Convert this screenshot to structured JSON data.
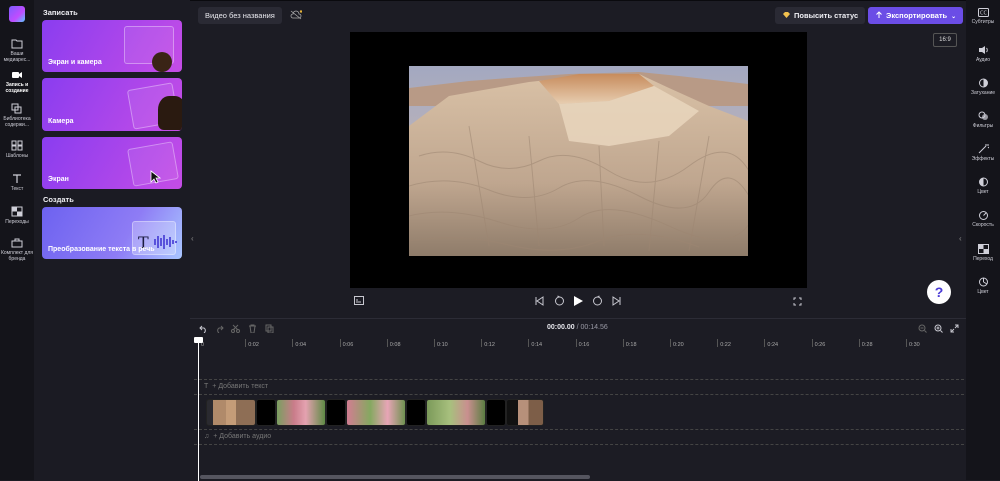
{
  "rail": {
    "items": [
      {
        "label": "Ваши медиарес...",
        "icon": "folder-icon"
      },
      {
        "label": "Запись и создание",
        "icon": "camera-icon"
      },
      {
        "label": "Библиотека содержи...",
        "icon": "library-icon"
      },
      {
        "label": "Шаблоны",
        "icon": "templates-icon"
      },
      {
        "label": "Текст",
        "icon": "text-icon"
      },
      {
        "label": "Переходы",
        "icon": "transitions-icon"
      },
      {
        "label": "Комплект для бренда",
        "icon": "brand-kit-icon"
      }
    ]
  },
  "panel": {
    "record_title": "Записать",
    "create_title": "Создать",
    "cards": [
      {
        "label": "Экран и камера"
      },
      {
        "label": "Камера"
      },
      {
        "label": "Экран"
      },
      {
        "label": "Преобразование текста в речь"
      }
    ]
  },
  "header": {
    "project_title": "Видео без названия",
    "upgrade_label": "Повысить статус",
    "export_label": "Экспортировать"
  },
  "preview": {
    "aspect_ratio": "16:9"
  },
  "right_rail": {
    "items": [
      {
        "label": "Субтитры",
        "icon": "captions-icon"
      },
      {
        "label": "Аудио",
        "icon": "audio-icon"
      },
      {
        "label": "Затухание",
        "icon": "fade-icon"
      },
      {
        "label": "Фильтры",
        "icon": "filters-icon"
      },
      {
        "label": "Эффекты",
        "icon": "effects-icon"
      },
      {
        "label": "Цвет",
        "icon": "color-icon"
      },
      {
        "label": "Скорость",
        "icon": "speed-icon"
      },
      {
        "label": "Переход",
        "icon": "transition-icon"
      },
      {
        "label": "Цвет",
        "icon": "color-wheel-icon"
      }
    ]
  },
  "timeline": {
    "current_time": "00:00.00",
    "duration": "/ 00:14.56",
    "ticks": [
      "0",
      "0:02",
      "0:04",
      "0:06",
      "0:08",
      "0:10",
      "0:12",
      "0:14",
      "0:16",
      "0:18",
      "0:20",
      "0:22",
      "0:24",
      "0:26",
      "0:28",
      "0:30"
    ],
    "add_text": "+ Добавить текст",
    "add_audio": "+ Добавить аудио"
  },
  "help_label": "?",
  "colors": {
    "accent": "#6b4de6",
    "panel": "#1b1b23",
    "rail": "#14141a"
  }
}
